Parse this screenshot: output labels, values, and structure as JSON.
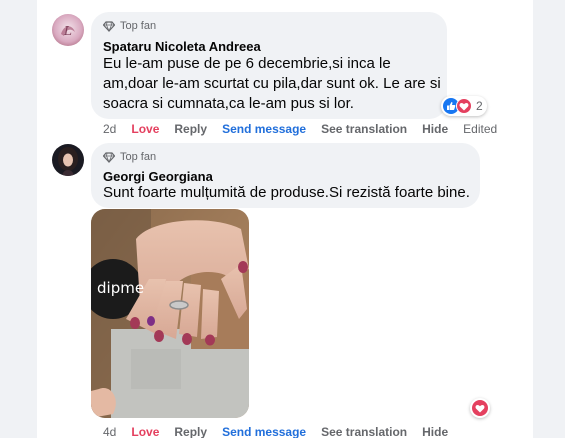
{
  "comments": [
    {
      "badge": "Top fan",
      "author": "Spataru Nicoleta Andreea",
      "text_lines": [
        "Eu le-am puse de pe 6 decembrie,si inca le",
        "am,doar le-am scurtat cu pila,dar sunt ok. Le are si",
        "soacra si cumnata,ca le-am pus si lor."
      ],
      "time": "2d",
      "love": "Love",
      "reply": "Reply",
      "send_message": "Send message",
      "see_translation": "See translation",
      "hide": "Hide",
      "edited": "Edited",
      "reaction_count": "2",
      "reaction_icons": [
        "like-icon",
        "love-icon"
      ]
    },
    {
      "badge": "Top fan",
      "author": "Georgi Georgiana",
      "text_lines": [
        "Sunt foarte mulțumită de produse.Si rezistă foarte bine."
      ],
      "photo_brand_text": "dipme",
      "time": "4d",
      "love": "Love",
      "reply": "Reply",
      "send_message": "Send message",
      "see_translation": "See translation",
      "hide": "Hide",
      "reaction_icons": [
        "love-icon"
      ]
    }
  ],
  "colors": {
    "love": "#e4405f",
    "send_message": "#216fdb",
    "like_blue": "#1877f2",
    "bubble": "#f0f2f5"
  }
}
